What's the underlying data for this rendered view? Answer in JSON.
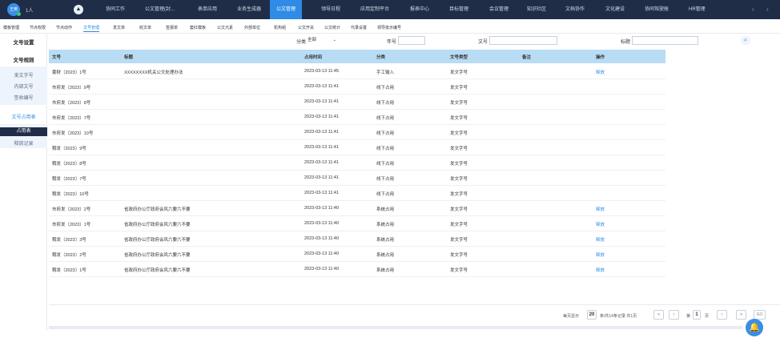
{
  "topbar": {
    "avatar_text": "王英",
    "user_count": "1人",
    "nav": [
      "协同工作",
      "公文管理(封...",
      "表单应用",
      "业务生成器",
      "公文管理",
      "领导日程",
      "应用定制平台",
      "报表中心",
      "目标管理",
      "会议管理",
      "知识社区",
      "文档协作",
      "文化建设",
      "协同驾驶舱",
      "HR管理"
    ],
    "active_nav": "公文管理",
    "prev_arrow": "‹",
    "next_arrow": "›"
  },
  "subnav": [
    "模板管理",
    "节点权限",
    "节点动作",
    "文号管理",
    "发文单",
    "收文单",
    "签报单",
    "套红模板",
    "公文元素",
    "外部单位",
    "机构组",
    "公文开关",
    "公文统计",
    "代录设置",
    "领导批示编号"
  ],
  "sidebar": {
    "head1": "文号设置",
    "head2": "文号规则",
    "group1": [
      "发文字号",
      "内部文号",
      "签收编号"
    ],
    "head3": "文号占用表",
    "group2_active": "占用表",
    "group2_other": "释放记录"
  },
  "filter": {
    "category_label": "分类",
    "category_value": "全部",
    "year_label": "年号",
    "docno_label": "文号",
    "title_label": "标题",
    "search_icon": "search-icon"
  },
  "table": {
    "headers": [
      "文号",
      "标题",
      "占用时间",
      "分类",
      "文号类型",
      "备注",
      "操作"
    ],
    "rows": [
      [
        "委财〔2023〕1号",
        "XXXXXXXX机关公文处理办法",
        "2023-03-13 11:45",
        "手工输入",
        "发文字号",
        "",
        "释放"
      ],
      [
        "市府发〔2023〕9号",
        "",
        "2023-03-13 11:41",
        "线下占用",
        "发文字号",
        "",
        ""
      ],
      [
        "市府发〔2023〕8号",
        "",
        "2023-03-13 11:41",
        "线下占用",
        "发文字号",
        "",
        ""
      ],
      [
        "市府发〔2023〕7号",
        "",
        "2023-03-13 11:41",
        "线下占用",
        "发文字号",
        "",
        ""
      ],
      [
        "市府发〔2023〕10号",
        "",
        "2023-03-13 11:41",
        "线下占用",
        "发文字号",
        "",
        ""
      ],
      [
        "稠发〔2023〕9号",
        "",
        "2023-03-13 11:41",
        "线下占用",
        "发文字号",
        "",
        ""
      ],
      [
        "稠发〔2023〕8号",
        "",
        "2023-03-13 11:41",
        "线下占用",
        "发文字号",
        "",
        ""
      ],
      [
        "稠发〔2023〕7号",
        "",
        "2023-03-13 11:41",
        "线下占用",
        "发文字号",
        "",
        ""
      ],
      [
        "稠发〔2023〕10号",
        "",
        "2023-03-13 11:41",
        "线下占用",
        "发文字号",
        "",
        ""
      ],
      [
        "市府发〔2023〕2号",
        "省政府办公厅政府会风六要六不要",
        "2023-03-13 11:40",
        "系统占用",
        "发文字号",
        "",
        "释放"
      ],
      [
        "市府发〔2023〕1号",
        "省政府办公厅政府会风六要六不要",
        "2023-03-13 11:40",
        "系统占用",
        "发文字号",
        "",
        "释放"
      ],
      [
        "稠发〔2023〕3号",
        "省政府办公厅政府会风六要六不要",
        "2023-03-13 11:40",
        "系统占用",
        "发文字号",
        "",
        "释放"
      ],
      [
        "稠发〔2023〕2号",
        "省政府办公厅政府会风六要六不要",
        "2023-03-13 11:40",
        "系统占用",
        "发文字号",
        "",
        "释放"
      ],
      [
        "稠发〔2023〕1号",
        "省政府办公厅政府会风六要六不要",
        "2023-03-13 11:40",
        "系统占用",
        "发文字号",
        "",
        "释放"
      ]
    ]
  },
  "pager": {
    "per_page_label": "每页显示",
    "per_page": "20",
    "total_text": "条/共14条记录 共1页",
    "page_prefix": "第",
    "page": "1",
    "page_suffix": "页",
    "go": "GO",
    "first": "«",
    "prev": "‹",
    "next": "›",
    "last": "»"
  },
  "bell_icon": "bell-icon"
}
